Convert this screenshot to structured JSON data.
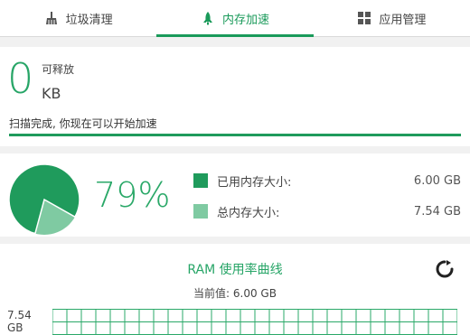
{
  "tabs": [
    {
      "label": "垃圾清理",
      "icon": "broom-icon",
      "active": false
    },
    {
      "label": "内存加速",
      "icon": "rocket-icon",
      "active": true
    },
    {
      "label": "应用管理",
      "icon": "apps-grid-icon",
      "active": false
    }
  ],
  "release": {
    "amount": "0",
    "label": "可释放",
    "unit": "KB",
    "status": "扫描完成, 你现在可以开始加速",
    "progress": 1.0
  },
  "memory": {
    "percent_text": "79%",
    "used_fraction": 0.79,
    "used_label": "已用内存大小:",
    "used_value": "6.00 GB",
    "total_label": "总内存大小:",
    "total_value": "7.54 GB"
  },
  "ram": {
    "title": "RAM 使用率曲线",
    "current": "当前值: 6.00 GB",
    "ymax_value": "7.54",
    "ymax_unit": "GB"
  },
  "colors": {
    "accent": "#1a9a5a",
    "used": "#1f9b5c",
    "total": "#7fcaa2"
  }
}
